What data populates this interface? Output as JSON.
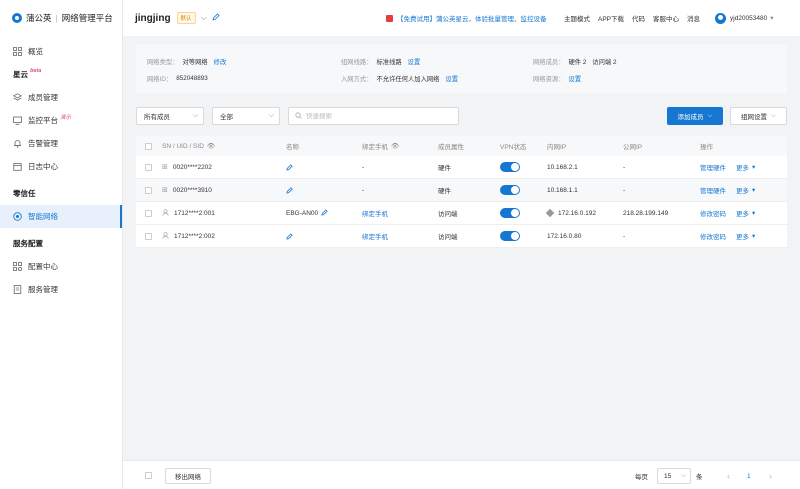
{
  "brand": {
    "name": "蒲公英",
    "platform": "网络管理平台"
  },
  "sidebar": {
    "items": [
      {
        "label": "概览"
      }
    ],
    "groups": [
      {
        "title": "星云",
        "badge": "beta"
      },
      {
        "title": "零信任"
      },
      {
        "title": "服务配置"
      }
    ],
    "xingyun_items": [
      {
        "label": "成员管理"
      },
      {
        "label": "监控平台",
        "badge": "演示"
      },
      {
        "label": "告警管理"
      },
      {
        "label": "日志中心"
      }
    ],
    "zerotrust_items": [
      {
        "label": "智能网络",
        "active": true
      }
    ],
    "service_items": [
      {
        "label": "配置中心"
      },
      {
        "label": "服务管理"
      }
    ]
  },
  "header": {
    "network_name": "jingjing",
    "default_tag": "默认",
    "promo": "【免费试用】蒲公英星云，体验批量管理、监控设备",
    "links": [
      "主题模式",
      "APP下载",
      "代码",
      "客服中心",
      "消息"
    ],
    "username": "yjd20053480"
  },
  "info": {
    "network_type_label": "网络类型：",
    "network_type_value": "对等网络",
    "network_type_edit": "修改",
    "network_id_label": "网络ID：",
    "network_id_value": "852048893",
    "link_label": "组网线路：",
    "link_value": "标准线路",
    "link_action": "设置",
    "join_label": "入网方式：",
    "join_value": "不允许任何人加入网络",
    "join_action": "设置",
    "members_label": "网络成员：",
    "members_hw": "硬件 2",
    "members_gw": "访问端 2",
    "resources_label": "网络资源：",
    "resources_action": "设置"
  },
  "filters": {
    "member_select": "所有成员",
    "all_select": "全部",
    "search_placeholder": "快速搜索",
    "add_member": "添加成员",
    "group_settings": "组网设置"
  },
  "table": {
    "columns": [
      "SN / UID / SID",
      "名称",
      "绑定手机",
      "成员属性",
      "VPN状态",
      "内网IP",
      "公网IP",
      "操作"
    ],
    "rows": [
      {
        "id": "0020****2202",
        "name": "",
        "phone": "-",
        "attr": "硬件",
        "vpn": true,
        "lan_ip": "10.168.2.1",
        "wan_ip": "-",
        "action": "管理硬件",
        "more": "更多",
        "kind": "device"
      },
      {
        "id": "0020****3910",
        "name": "",
        "phone": "-",
        "attr": "硬件",
        "vpn": true,
        "lan_ip": "10.168.1.1",
        "wan_ip": "-",
        "action": "管理硬件",
        "more": "更多",
        "kind": "device"
      },
      {
        "id": "1712****2:001",
        "name": "EBG-AN00",
        "phone": "绑定手机",
        "attr": "访问端",
        "vpn": true,
        "lan_ip": "172.16.0.192",
        "wan_ip": "218.28.199.149",
        "action": "修改密码",
        "more": "更多",
        "kind": "user"
      },
      {
        "id": "1712****2:002",
        "name": "",
        "phone": "绑定手机",
        "attr": "访问端",
        "vpn": true,
        "lan_ip": "172.16.0.80",
        "wan_ip": "-",
        "action": "修改密码",
        "more": "更多",
        "kind": "user"
      }
    ]
  },
  "footer": {
    "move_button": "移出网络",
    "per_page_label": "每页",
    "per_page_value": "15",
    "unit": "条",
    "page": "1",
    "prev": "‹",
    "next": "›"
  }
}
